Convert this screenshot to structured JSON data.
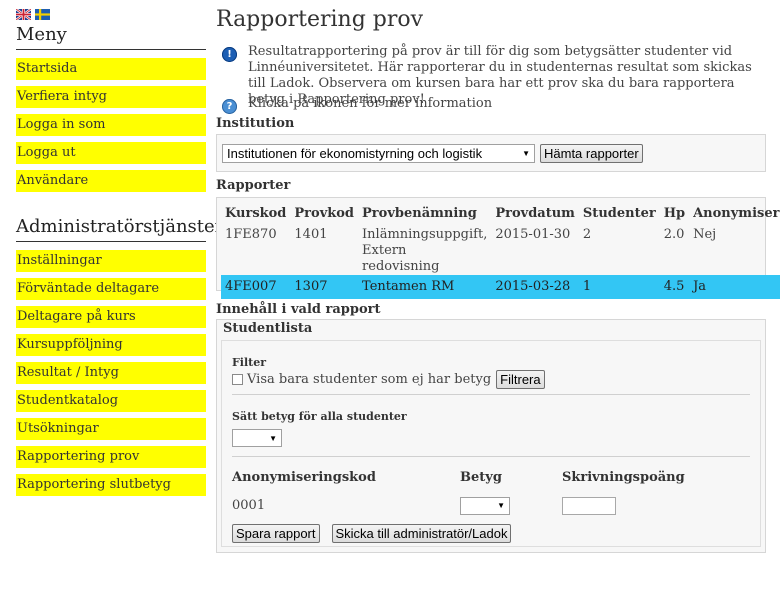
{
  "sidebar": {
    "menu_heading": "Meny",
    "menu_items": [
      "Startsida",
      "Verfiera intyg",
      "Logga in som",
      "Logga ut",
      "Användare"
    ],
    "admin_heading": "Administratörstjänster",
    "admin_items": [
      "Inställningar",
      "Förväntade deltagare",
      "Deltagare på kurs",
      "Kursuppföljning",
      "Resultat / Intyg",
      "Studentkatalog",
      "Utsökningar",
      "Rapportering prov",
      "Rapportering slutbetyg"
    ],
    "highlight_color": "#ffff00"
  },
  "main": {
    "title": "Rapportering prov",
    "info_text": "Resultatrapportering på prov är till för dig som betygsätter studenter vid Linnéuniversitetet. Här rapporterar du in studenternas resultat som skickas till Ladok. Observera om kursen bara har ett prov ska du bara rapportera betyg i Rapportering prov!",
    "help_text": "Klicka på ikonen för mer information",
    "institution": {
      "label": "Institution",
      "selected": "Institutionen för ekonomistyrning och logistik",
      "button": "Hämta rapporter"
    },
    "reports": {
      "label": "Rapporter",
      "columns": [
        "Kurskod",
        "Provkod",
        "Provbenämning",
        "Provdatum",
        "Studenter",
        "Hp",
        "Anonymiserad"
      ],
      "rows": [
        {
          "kurskod": "1FE870",
          "provkod": "1401",
          "benamning_1": "Inlämningsuppgift,",
          "benamning_2": "Extern redovisning",
          "datum": "2015-01-30",
          "studenter": "2",
          "hp": "2.0",
          "anonym": "Nej"
        },
        {
          "kurskod": "4FE007",
          "provkod": "1307",
          "benamning_1": "Tentamen RM",
          "benamning_2": "",
          "datum": "2015-03-28",
          "studenter": "1",
          "hp": "4.5",
          "anonym": "Ja"
        }
      ],
      "selected_row_color": "#33c6f4"
    },
    "content": {
      "label": "Innehåll i vald rapport",
      "studentlista": "Studentlista",
      "filter_label": "Filter",
      "filter_checkbox": "Visa bara studenter som ej har betyg",
      "filter_button": "Filtrera",
      "set_grade_label": "Sätt betyg för alla studenter",
      "columns": [
        "Anonymiseringskod",
        "Betyg",
        "Skrivningspoäng"
      ],
      "student_code": "0001",
      "save_button": "Spara rapport",
      "send_button": "Skicka till administratör/Ladok"
    }
  }
}
